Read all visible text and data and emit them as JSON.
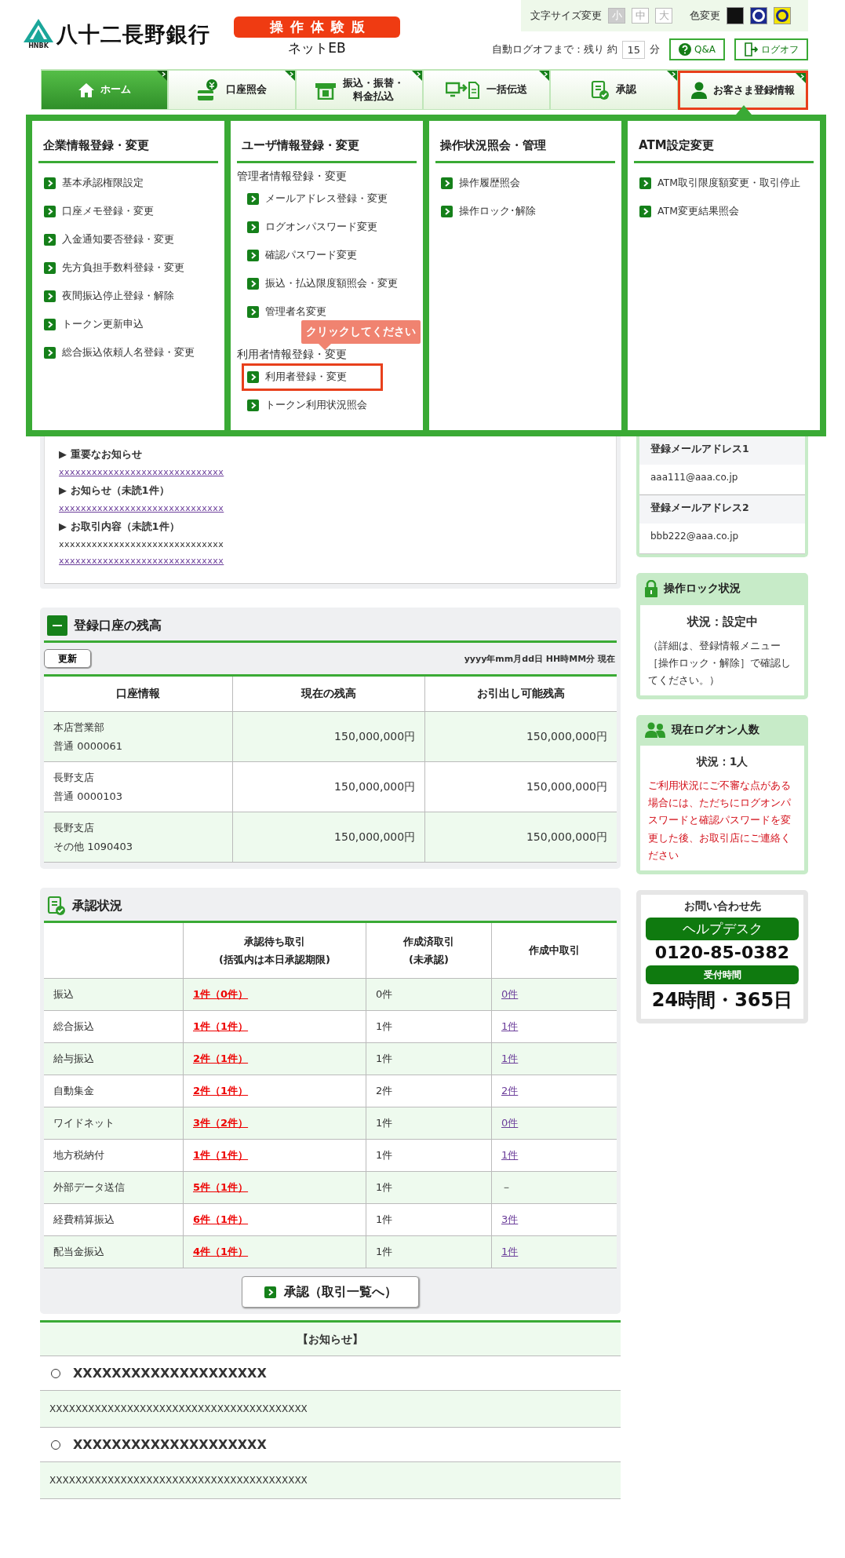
{
  "header": {
    "bank_name": "八十二長野銀行",
    "logo_caption": "HNBK",
    "trial_badge": "操作体験版",
    "product": "ネットEB",
    "font_size": {
      "label": "文字サイズ変更",
      "options": [
        {
          "label": "小",
          "selected": true
        },
        {
          "label": "中",
          "selected": false
        },
        {
          "label": "大",
          "selected": false
        }
      ]
    },
    "color_change": {
      "label": "色変更",
      "options": [
        {
          "color": "#111111"
        },
        {
          "color": "#1b2a8f"
        },
        {
          "color": "#f2e400"
        }
      ]
    },
    "auto_logoff": {
      "label": "自動ログオフまで：残り 約",
      "value": "15",
      "unit": "分"
    },
    "buttons": [
      {
        "kind": "help",
        "label": "Q&A"
      },
      {
        "kind": "logoff",
        "label": "ログオフ"
      }
    ]
  },
  "nav": {
    "tabs": [
      {
        "kind": "home",
        "lines": [
          "ホーム"
        ],
        "current": true,
        "selected": false
      },
      {
        "kind": "account",
        "lines": [
          "口座照会"
        ],
        "current": false,
        "selected": false
      },
      {
        "kind": "transfer",
        "lines": [
          "振込・振替・",
          "料金払込"
        ],
        "current": false,
        "selected": false
      },
      {
        "kind": "bulk",
        "lines": [
          "一括伝送"
        ],
        "current": false,
        "selected": false
      },
      {
        "kind": "approve",
        "lines": [
          "承認"
        ],
        "current": false,
        "selected": false
      },
      {
        "kind": "user",
        "lines": [
          "お客さま登録情報"
        ],
        "current": false,
        "selected": true
      }
    ]
  },
  "mega_menu": {
    "tooltip": "クリックしてください",
    "columns": [
      {
        "title": "企業情報登録・変更",
        "groups": [
          {
            "items": [
              {
                "label": "基本承認権限設定",
                "highlighted": false
              },
              {
                "label": "口座メモ登録・変更",
                "highlighted": false
              },
              {
                "label": "入金通知要否登録・変更",
                "highlighted": false
              },
              {
                "label": "先方負担手数料登録・変更",
                "highlighted": false
              },
              {
                "label": "夜間振込停止登録・解除",
                "highlighted": false
              },
              {
                "label": "トークン更新申込",
                "highlighted": false
              },
              {
                "label": "総合振込依頼人名登録・変更",
                "highlighted": false
              }
            ]
          }
        ]
      },
      {
        "title": "ユーザ情報登録・変更",
        "groups": [
          {
            "heading": "管理者情報登録・変更",
            "items": [
              {
                "label": "メールアドレス登録・変更",
                "highlighted": false
              },
              {
                "label": "ログオンパスワード変更",
                "highlighted": false
              },
              {
                "label": "確認パスワード変更",
                "highlighted": false
              },
              {
                "label": "振込・払込限度額照会・変更",
                "highlighted": false
              },
              {
                "label": "管理者名変更",
                "highlighted": false
              }
            ]
          },
          {
            "heading": "利用者情報登録・変更",
            "items": [
              {
                "label": "利用者登録・変更",
                "highlighted": true
              },
              {
                "label": "トークン利用状況照会",
                "highlighted": false
              }
            ]
          }
        ]
      },
      {
        "title": "操作状況照会・管理",
        "groups": [
          {
            "items": [
              {
                "label": "操作履歴照会",
                "highlighted": false
              },
              {
                "label": "操作ロック･解除",
                "highlighted": false
              }
            ]
          }
        ]
      },
      {
        "title": "ATM設定変更",
        "groups": [
          {
            "items": [
              {
                "label": "ATM取引限度額変更・取引停止",
                "highlighted": false
              },
              {
                "label": "ATM変更結果照会",
                "highlighted": false
              }
            ]
          }
        ]
      }
    ]
  },
  "notices": [
    {
      "title": "▶ 重要なお知らせ",
      "lines": [
        {
          "text": "xxxxxxxxxxxxxxxxxxxxxxxxxxxxxx",
          "link": true
        }
      ]
    },
    {
      "title": "▶ お知らせ（未読1件）",
      "lines": [
        {
          "text": "xxxxxxxxxxxxxxxxxxxxxxxxxxxxxx",
          "link": true
        }
      ]
    },
    {
      "title": "▶ お取引内容（未読1件）",
      "lines": [
        {
          "text": "xxxxxxxxxxxxxxxxxxxxxxxxxxxxxx",
          "link": false
        },
        {
          "text": "xxxxxxxxxxxxxxxxxxxxxxxxxxxxxx",
          "link": true
        }
      ]
    }
  ],
  "balance": {
    "title": "登録口座の残高",
    "refresh": "更新",
    "timestamp": "yyyy年mm月dd日 HH時MM分 現在",
    "columns": [
      "口座情報",
      "現在の残高",
      "お引出し可能残高"
    ],
    "rows": [
      {
        "branch": "本店営業部",
        "account": "普通 0000061",
        "current": "150,000,000円",
        "available": "150,000,000円"
      },
      {
        "branch": "長野支店",
        "account": "普通 0000103",
        "current": "150,000,000円",
        "available": "150,000,000円"
      },
      {
        "branch": "長野支店",
        "account": "その他 1090403",
        "current": "150,000,000円",
        "available": "150,000,000円"
      }
    ]
  },
  "approval": {
    "title": "承認状況",
    "columns": [
      "承認待ち取引\n(括弧内は本日承認期限)",
      "作成済取引\n(未承認)",
      "作成中取引"
    ],
    "rows": [
      {
        "name": "振込",
        "pending": "1件（0件）",
        "created": "0件",
        "in_progress": "0件",
        "link": true
      },
      {
        "name": "総合振込",
        "pending": "1件（1件）",
        "created": "1件",
        "in_progress": "1件",
        "link": true
      },
      {
        "name": "給与振込",
        "pending": "2件（1件）",
        "created": "1件",
        "in_progress": "1件",
        "link": true
      },
      {
        "name": "自動集金",
        "pending": "2件（1件）",
        "created": "2件",
        "in_progress": "2件",
        "link": true
      },
      {
        "name": "ワイドネット",
        "pending": "3件（2件）",
        "created": "1件",
        "in_progress": "0件",
        "link": true
      },
      {
        "name": "地方税納付",
        "pending": "1件（1件）",
        "created": "1件",
        "in_progress": "1件",
        "link": true
      },
      {
        "name": "外部データ送信",
        "pending": "5件（1件）",
        "created": "1件",
        "in_progress": "－",
        "link": false
      },
      {
        "name": "経費精算振込",
        "pending": "6件（1件）",
        "created": "1件",
        "in_progress": "3件",
        "link": true
      },
      {
        "name": "配当金振込",
        "pending": "4件（1件）",
        "created": "1件",
        "in_progress": "1件",
        "link": true
      }
    ],
    "button": "承認（取引一覧へ）"
  },
  "news": {
    "title": "【お知らせ】",
    "items": [
      {
        "title": "XXXXXXXXXXXXXXXXXXXX",
        "body": "XXXXXXXXXXXXXXXXXXXXXXXXXXXXXXXXXXXXXXXX"
      },
      {
        "title": "XXXXXXXXXXXXXXXXXXXX",
        "body": "XXXXXXXXXXXXXXXXXXXXXXXXXXXXXXXXXXXXXXXX"
      }
    ]
  },
  "emails": [
    {
      "label": "登録メールアドレス1",
      "value": "aaa111@aaa.co.jp"
    },
    {
      "label": "登録メールアドレス2",
      "value": "bbb222@aaa.co.jp"
    }
  ],
  "lock_status": {
    "title": "操作ロック状況",
    "status": "状況：設定中",
    "note": "（詳細は、登録情報メニュー［操作ロック・解除］で確認してください。）"
  },
  "logon_count": {
    "title": "現在ログオン人数",
    "status": "状況：1人",
    "warning": "ご利用状況にご不審な点がある場合には、ただちにログオンパスワードと確認パスワードを変更した後、お取引店にご連絡ください"
  },
  "contact": {
    "title": "お問い合わせ先",
    "desk": "ヘルプデスク",
    "phone": "0120-85-0382",
    "hours_label": "受付時間",
    "hours": "24時間・365日"
  }
}
